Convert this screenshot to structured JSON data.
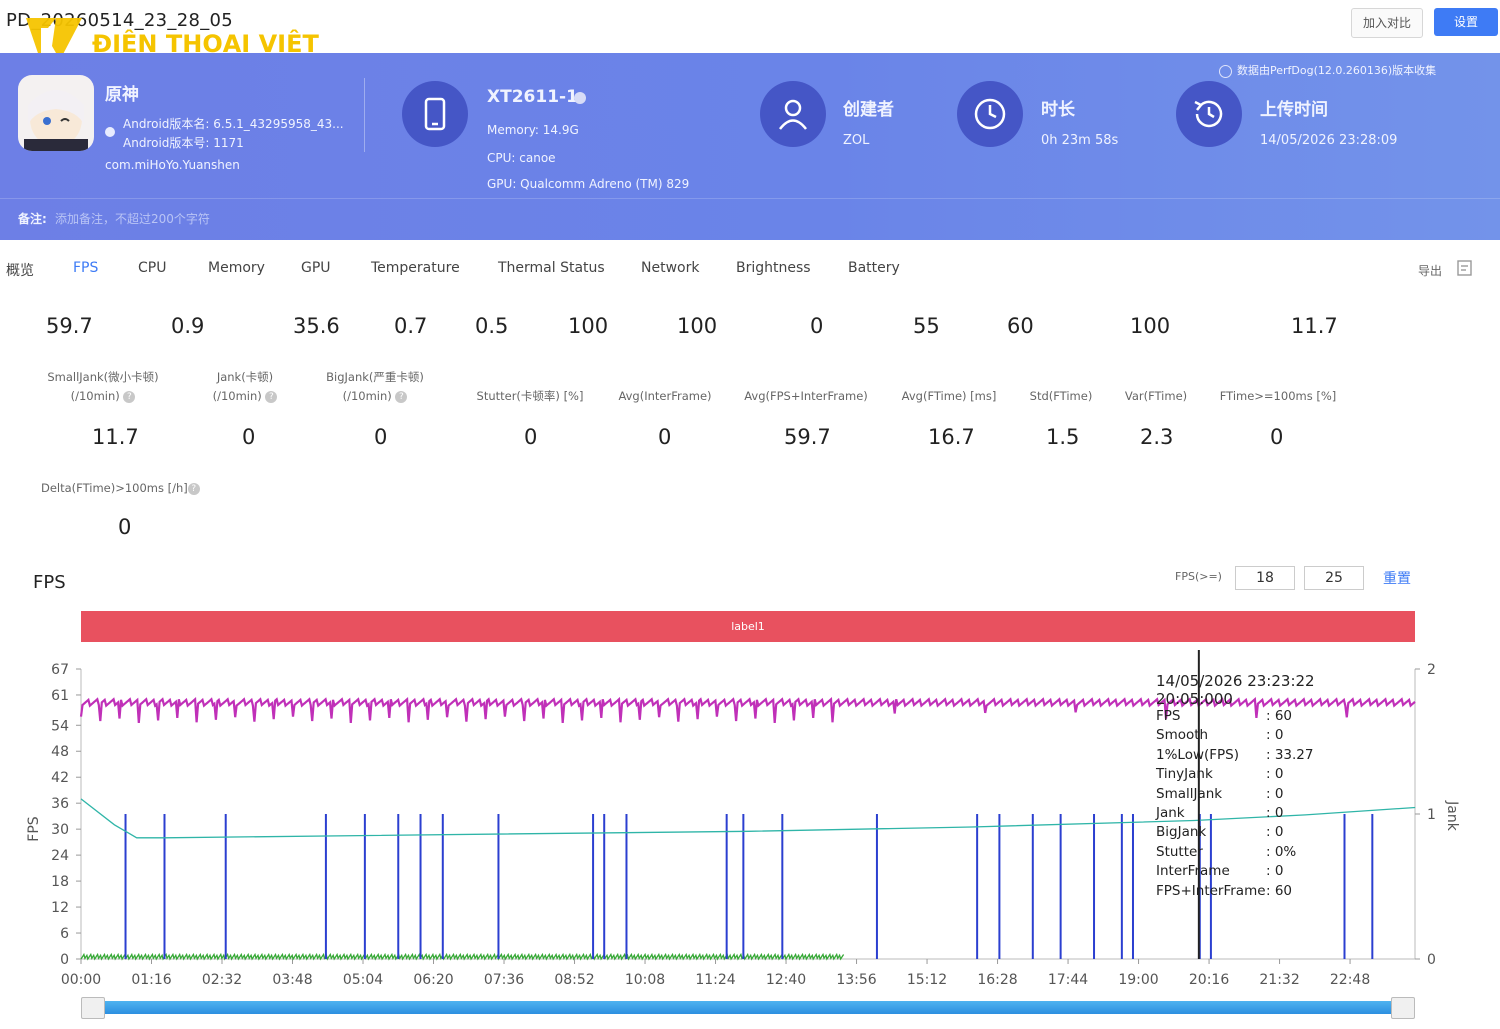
{
  "page": {
    "title": "PD_20260514_23_28_05",
    "watermark": "ĐIỆN THOẠI VIỆT",
    "compare_label": "加入对比",
    "settings_label": "设置"
  },
  "banner": {
    "game_name": "原神",
    "android_version_name": "Android版本名: 6.5.1_43295958_43...",
    "android_version_code": "Android版本号: 1171",
    "package": "com.miHoYo.Yuanshen",
    "device_name": "XT2611-1",
    "memory": "Memory: 14.9G",
    "cpu": "CPU: canoe",
    "gpu": "GPU: Qualcomm Adreno (TM) 829",
    "creator_label": "创建者",
    "creator_value": "ZOL",
    "duration_label": "时长",
    "duration_value": "0h 23m 58s",
    "upload_label": "上传时间",
    "upload_value": "14/05/2026 23:28:09",
    "collected_note": "数据由PerfDog(12.0.260136)版本收集",
    "remark_label": "备注:",
    "remark_placeholder": "添加备注，不超过200个字符"
  },
  "tabs": {
    "items": [
      "概览",
      "FPS",
      "CPU",
      "Memory",
      "GPU",
      "Temperature",
      "Thermal Status",
      "Network",
      "Brightness",
      "Battery"
    ],
    "active": "FPS",
    "export_label": "导出"
  },
  "stats": {
    "row1_values": [
      "59.7",
      "0.9",
      "35.6",
      "0.7",
      "0.5",
      "100",
      "100",
      "0",
      "55",
      "60",
      "100",
      "11.7"
    ],
    "row2": [
      {
        "label1": "SmallJank(微小卡顿)",
        "label2": "(/10min)",
        "value": "11.7"
      },
      {
        "label1": "Jank(卡顿)",
        "label2": "(/10min)",
        "value": "0"
      },
      {
        "label1": "BigJank(严重卡顿)",
        "label2": "(/10min)",
        "value": "0"
      },
      {
        "label1": "Stutter(卡顿率) [%]",
        "label2": "",
        "value": "0"
      },
      {
        "label1": "Avg(InterFrame)",
        "label2": "",
        "value": "0"
      },
      {
        "label1": "Avg(FPS+InterFrame)",
        "label2": "",
        "value": "59.7"
      },
      {
        "label1": "Avg(FTime) [ms]",
        "label2": "",
        "value": "16.7"
      },
      {
        "label1": "Std(FTime)",
        "label2": "",
        "value": "1.5"
      },
      {
        "label1": "Var(FTime)",
        "label2": "",
        "value": "2.3"
      },
      {
        "label1": "FTime>=100ms [%]",
        "label2": "",
        "value": "0"
      }
    ],
    "row3": {
      "label": "Delta(FTime)>100ms [/h]",
      "value": "0"
    }
  },
  "fps_panel": {
    "title": "FPS",
    "threshold_label": "FPS(>=)",
    "threshold_1": "18",
    "threshold_2": "25",
    "reset_label": "重置",
    "band_label": "label1",
    "tooltip": {
      "time": "14/05/2026 23:23:22",
      "offset": "20:05:000",
      "rows": [
        {
          "k": "FPS",
          "v": ": 60"
        },
        {
          "k": "Smooth",
          "v": ": 0"
        },
        {
          "k": "1%Low(FPS)",
          "v": ": 33.27"
        },
        {
          "k": "TinyJank",
          "v": ": 0"
        },
        {
          "k": "SmallJank",
          "v": ": 0"
        },
        {
          "k": "Jank",
          "v": ": 0"
        },
        {
          "k": "BigJank",
          "v": ": 0"
        },
        {
          "k": "Stutter",
          "v": ": 0%"
        },
        {
          "k": "InterFrame",
          "v": ": 0"
        },
        {
          "k": "FPS+InterFrame",
          "v": ": 60"
        }
      ]
    }
  },
  "chart_data": {
    "type": "line",
    "ylabel": "FPS",
    "y2label": "Jank",
    "y_ticks": [
      0,
      6,
      12,
      18,
      24,
      30,
      36,
      42,
      48,
      54,
      61,
      67
    ],
    "ylim": [
      0,
      67
    ],
    "y2_ticks": [
      0,
      1,
      2
    ],
    "y2lim": [
      0,
      2
    ],
    "x_ticks": [
      "00:00",
      "01:16",
      "02:32",
      "03:48",
      "05:04",
      "06:20",
      "07:36",
      "08:52",
      "10:08",
      "11:24",
      "12:40",
      "13:56",
      "15:12",
      "16:28",
      "17:44",
      "19:00",
      "20:16",
      "21:32",
      "22:48"
    ],
    "xlim_seconds": [
      0,
      1438
    ],
    "cursor_time": "20:05",
    "series": [
      {
        "name": "FPS",
        "color": "#c030b8",
        "approx_value": 60
      },
      {
        "name": "1%Low(FPS)",
        "color": "#2fb5a8",
        "x_minutes": [
          0,
          0.6,
          1,
          1.5,
          5,
          12,
          16,
          20,
          22,
          23.97
        ],
        "values": [
          37,
          31,
          28,
          28,
          28.5,
          29.5,
          30.5,
          32,
          33.3,
          35
        ]
      },
      {
        "name": "Jank",
        "color": "#2b3fd0",
        "spike_minutes": [
          0.8,
          1.5,
          2.6,
          4.4,
          5.1,
          5.7,
          6.1,
          6.5,
          7.5,
          9.2,
          9.4,
          9.8,
          11.6,
          11.9,
          12.6,
          14.3,
          16.1,
          16.5,
          17.1,
          17.6,
          18.2,
          18.7,
          18.9,
          20.1,
          20.3,
          22.7,
          23.2
        ]
      },
      {
        "name": "InterFrame",
        "color": "#36a836",
        "approx_value": 0
      }
    ]
  }
}
